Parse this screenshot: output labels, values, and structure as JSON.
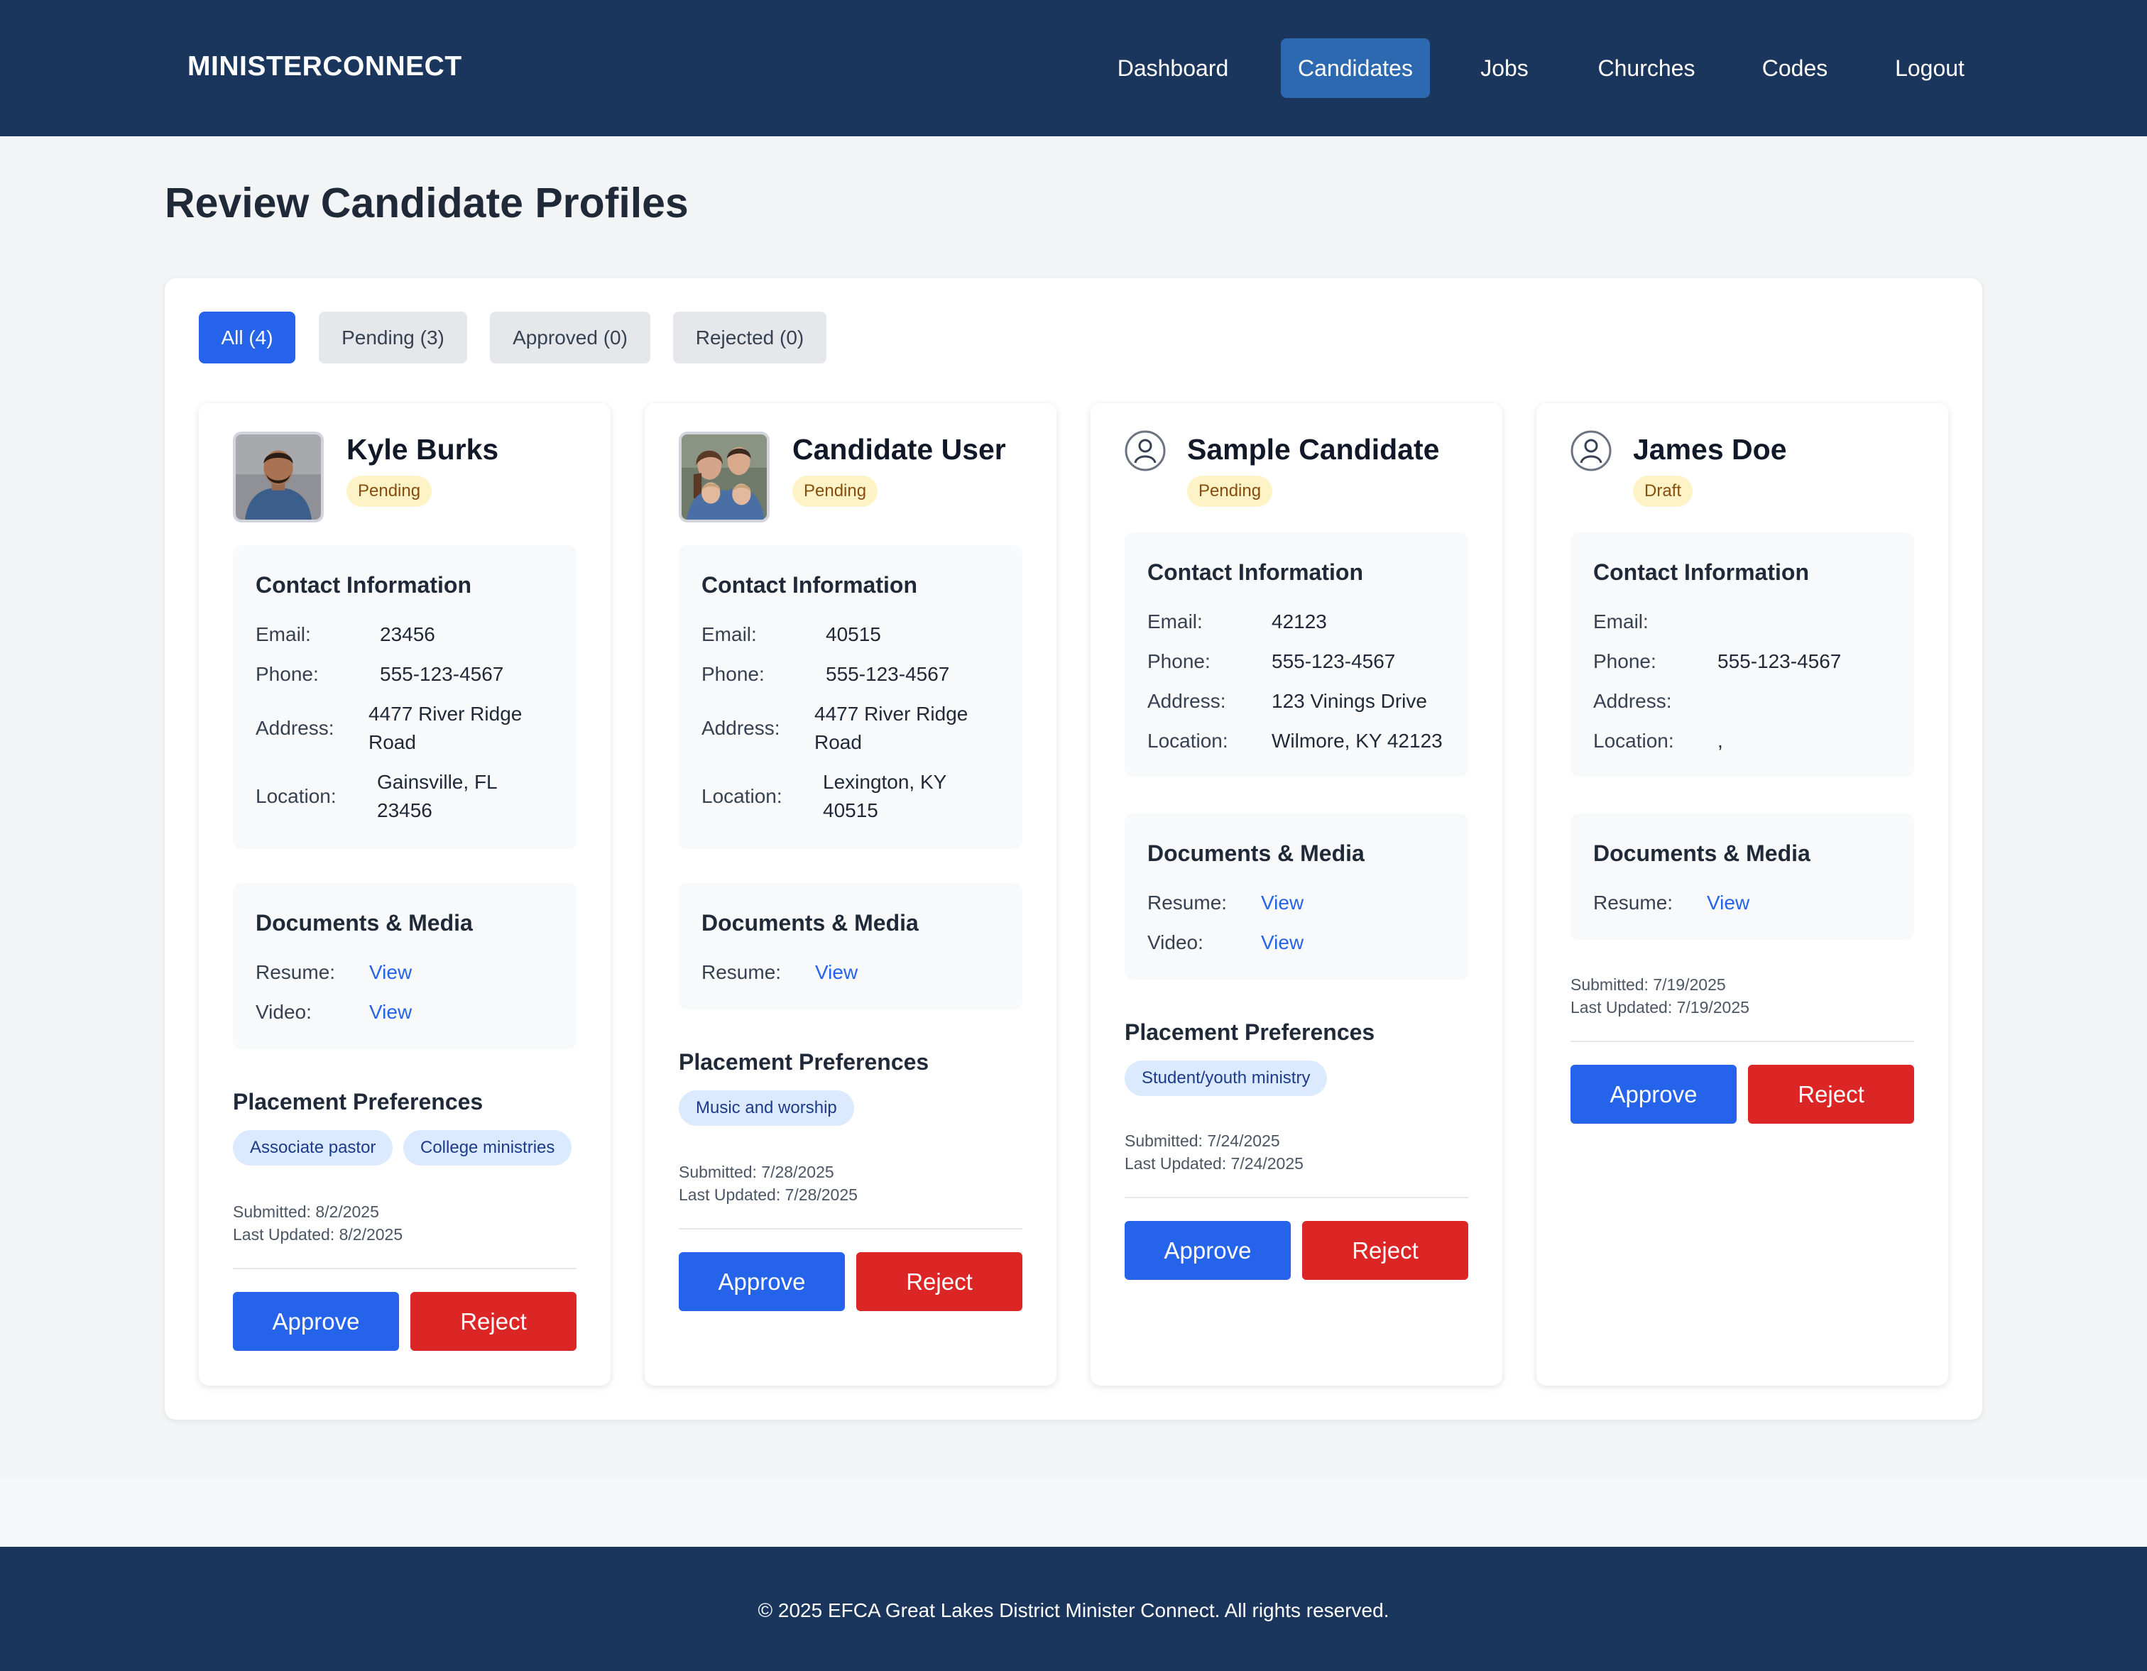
{
  "app": {
    "brand": "MINISTERCONNECT"
  },
  "nav": {
    "items": [
      {
        "label": "Dashboard"
      },
      {
        "label": "Candidates"
      },
      {
        "label": "Jobs"
      },
      {
        "label": "Churches"
      },
      {
        "label": "Codes"
      },
      {
        "label": "Logout"
      }
    ],
    "active": "Candidates"
  },
  "page": {
    "title": "Review Candidate Profiles"
  },
  "filters": {
    "tabs": [
      {
        "label": "All (4)"
      },
      {
        "label": "Pending (3)"
      },
      {
        "label": "Approved (0)"
      },
      {
        "label": "Rejected (0)"
      }
    ],
    "active": "All (4)"
  },
  "labels": {
    "contact_title": "Contact Information",
    "email": "Email:",
    "phone": "Phone:",
    "address": "Address:",
    "location": "Location:",
    "docs_title": "Documents & Media",
    "resume": "Resume:",
    "video": "Video:",
    "view": "View",
    "prefs_title": "Placement Preferences",
    "approve": "Approve",
    "reject": "Reject"
  },
  "candidates": [
    {
      "name": "Kyle Burks",
      "status": "Pending",
      "avatar": "photo-man",
      "email": "23456",
      "phone": "555-123-4567",
      "address": "4477 River Ridge Road",
      "location": "Gainsville, FL 23456",
      "preferences": [
        "Associate pastor",
        "College ministries"
      ],
      "submitted": "Submitted: 8/2/2025",
      "updated": "Last Updated: 8/2/2025"
    },
    {
      "name": "Candidate User",
      "status": "Pending",
      "avatar": "photo-family",
      "email": "40515",
      "phone": "555-123-4567",
      "address": "4477 River Ridge Road",
      "location": "Lexington, KY 40515",
      "preferences": [
        "Music and worship"
      ],
      "submitted": "Submitted: 7/28/2025",
      "updated": "Last Updated: 7/28/2025"
    },
    {
      "name": "Sample Candidate",
      "status": "Pending",
      "avatar": "user-icon",
      "email": "42123",
      "phone": "555-123-4567",
      "address": "123 Vinings Drive",
      "location": "Wilmore, KY 42123",
      "preferences": [
        "Student/youth ministry"
      ],
      "submitted": "Submitted: 7/24/2025",
      "updated": "Last Updated: 7/24/2025"
    },
    {
      "name": "James Doe",
      "status": "Draft",
      "avatar": "user-icon",
      "email": "",
      "phone": "555-123-4567",
      "address": "",
      "location": ",",
      "preferences": [],
      "submitted": "Submitted: 7/19/2025",
      "updated": "Last Updated: 7/19/2025"
    }
  ],
  "footer": {
    "text": "© 2025 EFCA Great Lakes District Minister Connect. All rights reserved."
  },
  "colors": {
    "header_bg": "#1b365d",
    "nav_active": "#2c69b0",
    "primary": "#2563eb",
    "danger": "#dc2626",
    "badge_bg": "#fef3c7",
    "pill_bg": "#dbeafe"
  }
}
